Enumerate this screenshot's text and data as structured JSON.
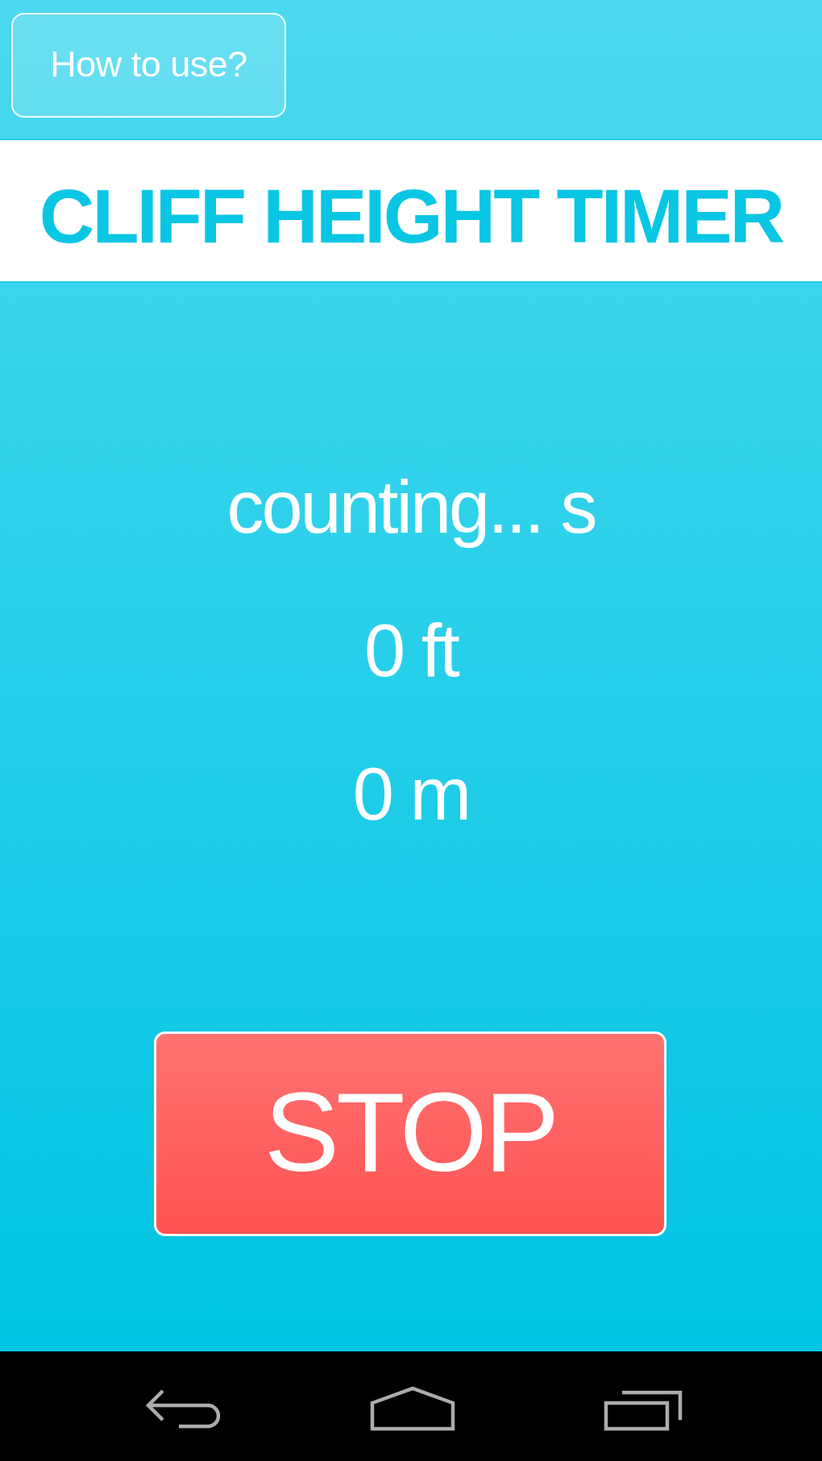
{
  "help_button": {
    "label": "How to use?"
  },
  "title": "CLIFF HEIGHT TIMER",
  "readouts": [
    "counting... s",
    "0 ft",
    "0 m"
  ],
  "stop_button": {
    "label": "STOP"
  }
}
